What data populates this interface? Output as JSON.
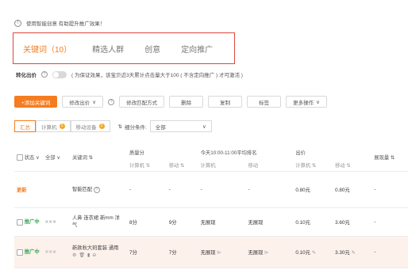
{
  "tip": {
    "icon": "info-circle-icon",
    "text": "使用智能创意 有助提升推广效果！"
  },
  "tabs": [
    {
      "label": "关键词（10）",
      "active": true
    },
    {
      "label": "精选人群",
      "active": false
    },
    {
      "label": "创意",
      "active": false
    },
    {
      "label": "定向推广",
      "active": false
    }
  ],
  "conversion": {
    "label": "转化出价",
    "help_icon": "question-icon",
    "note": "( 为保证效果，该宝贝近3天累计点击量大于100 ( 不含定向推广 ) 才可激活 )"
  },
  "toolbar": {
    "add_keyword": "+添加关键词",
    "modify_bid": "修改出价",
    "modify_match": "修改匹配方式",
    "delete": "删除",
    "copy": "复制",
    "mark": "标签",
    "more": "更多操作"
  },
  "filters": {
    "summary": "汇总",
    "computer": "计算机",
    "computer_badge": "3",
    "mobile": "移动设备",
    "mobile_badge": "3",
    "breakdown_label": "细分条件:",
    "breakdown_value": "全部"
  },
  "table": {
    "header": {
      "status": "状态",
      "all": "全部",
      "keyword": "关键词",
      "quality": "质量分",
      "rank": "今天10:00-11:00平均排名",
      "bid": "出价",
      "impressions": "展现量"
    },
    "subheader": {
      "quality_pc": "计算机",
      "quality_mobile": "移动",
      "rank_pc": "计算机",
      "rank_mobile": "移动",
      "bid_pc": "计算机",
      "bid_mobile": "移动"
    },
    "rows": [
      {
        "status": "更新",
        "keyword": "智能匹配",
        "quality_pc": "-",
        "quality_mobile": "-",
        "rank_pc": "-",
        "rank_mobile": "-",
        "bid_pc": "0.80元",
        "bid_mobile": "0.80元",
        "impressions": "-"
      },
      {
        "status": "推广中",
        "keyword": "人鼻 连衣裙 新mm 洋气",
        "quality_pc": "8分",
        "quality_mobile": "9分",
        "rank_pc": "无展现",
        "rank_mobile": "无展现",
        "bid_pc": "0.10元",
        "bid_mobile": "3.60元",
        "impressions": "-"
      },
      {
        "status": "推广中",
        "keyword": "新款秋大码套装 通用",
        "quality_pc": "7分",
        "quality_mobile": "7分",
        "rank_pc": "无展现",
        "rank_mobile": "无展现",
        "bid_pc": "0.10元",
        "bid_mobile": "3.30元",
        "impressions": "-"
      }
    ]
  }
}
